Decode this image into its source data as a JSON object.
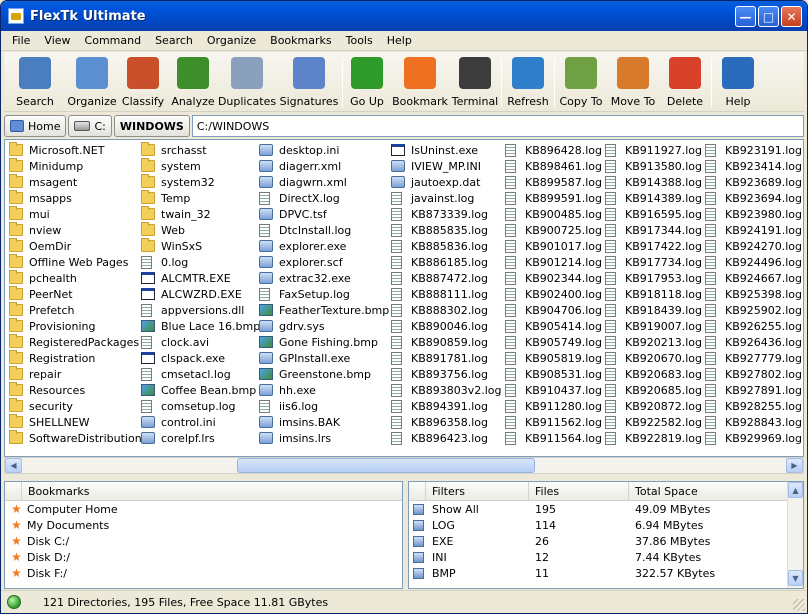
{
  "window": {
    "title": "FlexTk Ultimate"
  },
  "menu": [
    "File",
    "View",
    "Command",
    "Search",
    "Organize",
    "Bookmarks",
    "Tools",
    "Help"
  ],
  "toolbar": [
    {
      "label": "Search",
      "icon": "magnifier-icon",
      "color": "#4a7ebf"
    },
    {
      "label": "Organize",
      "icon": "organize-grid-icon",
      "color": "#5b8fd1"
    },
    {
      "label": "Classify",
      "icon": "classify-icon",
      "color": "#c9502b"
    },
    {
      "label": "Analyze",
      "icon": "analyze-drive-icon",
      "color": "#3f8e2c"
    },
    {
      "label": "Duplicates",
      "icon": "duplicates-icon",
      "color": "#8aa0bd"
    },
    {
      "label": "Signatures",
      "icon": "signatures-icon",
      "color": "#5d84c9"
    },
    {
      "label": "Go Up",
      "icon": "go-up-arrow-icon",
      "color": "#2f9b2a"
    },
    {
      "label": "Bookmark",
      "icon": "bookmark-star-icon",
      "color": "#ee7020"
    },
    {
      "label": "Terminal",
      "icon": "terminal-icon",
      "color": "#3c3c3c"
    },
    {
      "label": "Refresh",
      "icon": "refresh-icon",
      "color": "#2f7fcc"
    },
    {
      "label": "Copy To",
      "icon": "copy-to-icon",
      "color": "#6fa043"
    },
    {
      "label": "Move To",
      "icon": "move-to-icon",
      "color": "#d77a2c"
    },
    {
      "label": "Delete",
      "icon": "delete-icon",
      "color": "#d9412a"
    },
    {
      "label": "Help",
      "icon": "help-icon",
      "color": "#2a6bbd"
    }
  ],
  "address": {
    "crumbs": [
      "Home",
      "C:",
      "WINDOWS"
    ],
    "path": "C:/WINDOWS"
  },
  "files": {
    "columns": [
      [
        {
          "name": "Microsoft.NET",
          "type": "folder"
        },
        {
          "name": "Minidump",
          "type": "folder"
        },
        {
          "name": "msagent",
          "type": "folder"
        },
        {
          "name": "msapps",
          "type": "folder"
        },
        {
          "name": "mui",
          "type": "folder"
        },
        {
          "name": "nview",
          "type": "folder"
        },
        {
          "name": "OemDir",
          "type": "folder"
        },
        {
          "name": "Offline Web Pages",
          "type": "folder"
        },
        {
          "name": "pchealth",
          "type": "folder"
        },
        {
          "name": "PeerNet",
          "type": "folder"
        },
        {
          "name": "Prefetch",
          "type": "folder"
        },
        {
          "name": "Provisioning",
          "type": "folder"
        },
        {
          "name": "RegisteredPackages",
          "type": "folder"
        },
        {
          "name": "Registration",
          "type": "folder"
        },
        {
          "name": "repair",
          "type": "folder"
        },
        {
          "name": "Resources",
          "type": "folder"
        },
        {
          "name": "security",
          "type": "folder"
        },
        {
          "name": "SHELLNEW",
          "type": "folder"
        },
        {
          "name": "SoftwareDistribution",
          "type": "folder"
        }
      ],
      [
        {
          "name": "srchasst",
          "type": "folder"
        },
        {
          "name": "system",
          "type": "folder"
        },
        {
          "name": "system32",
          "type": "folder"
        },
        {
          "name": "Temp",
          "type": "folder"
        },
        {
          "name": "twain_32",
          "type": "folder"
        },
        {
          "name": "Web",
          "type": "folder"
        },
        {
          "name": "WinSxS",
          "type": "folder"
        },
        {
          "name": "0.log",
          "type": "doc"
        },
        {
          "name": "ALCMTR.EXE",
          "type": "exe"
        },
        {
          "name": "ALCWZRD.EXE",
          "type": "exe"
        },
        {
          "name": "appversions.dll",
          "type": "doc"
        },
        {
          "name": "Blue Lace 16.bmp",
          "type": "img"
        },
        {
          "name": "clock.avi",
          "type": "doc"
        },
        {
          "name": "clspack.exe",
          "type": "exe"
        },
        {
          "name": "cmsetacl.log",
          "type": "doc"
        },
        {
          "name": "Coffee Bean.bmp",
          "type": "img"
        },
        {
          "name": "comsetup.log",
          "type": "doc"
        },
        {
          "name": "control.ini",
          "type": "misc"
        },
        {
          "name": "corelpf.lrs",
          "type": "misc"
        }
      ],
      [
        {
          "name": "desktop.ini",
          "type": "misc"
        },
        {
          "name": "diagerr.xml",
          "type": "misc"
        },
        {
          "name": "diagwrn.xml",
          "type": "misc"
        },
        {
          "name": "DirectX.log",
          "type": "doc"
        },
        {
          "name": "DPVC.tsf",
          "type": "misc"
        },
        {
          "name": "DtcInstall.log",
          "type": "doc"
        },
        {
          "name": "explorer.exe",
          "type": "misc"
        },
        {
          "name": "explorer.scf",
          "type": "misc"
        },
        {
          "name": "extrac32.exe",
          "type": "misc"
        },
        {
          "name": "FaxSetup.log",
          "type": "doc"
        },
        {
          "name": "FeatherTexture.bmp",
          "type": "img"
        },
        {
          "name": "gdrv.sys",
          "type": "misc"
        },
        {
          "name": "Gone Fishing.bmp",
          "type": "img"
        },
        {
          "name": "GPInstall.exe",
          "type": "misc"
        },
        {
          "name": "Greenstone.bmp",
          "type": "img"
        },
        {
          "name": "hh.exe",
          "type": "misc"
        },
        {
          "name": "iis6.log",
          "type": "doc"
        },
        {
          "name": "imsins.BAK",
          "type": "misc"
        },
        {
          "name": "imsins.lrs",
          "type": "misc"
        }
      ],
      [
        {
          "name": "IsUninst.exe",
          "type": "exe"
        },
        {
          "name": "IVIEW_MP.INI",
          "type": "misc"
        },
        {
          "name": "jautoexp.dat",
          "type": "misc"
        },
        {
          "name": "javainst.log",
          "type": "doc"
        },
        {
          "name": "KB873339.log",
          "type": "doc"
        },
        {
          "name": "KB885835.log",
          "type": "doc"
        },
        {
          "name": "KB885836.log",
          "type": "doc"
        },
        {
          "name": "KB886185.log",
          "type": "doc"
        },
        {
          "name": "KB887472.log",
          "type": "doc"
        },
        {
          "name": "KB888111.log",
          "type": "doc"
        },
        {
          "name": "KB888302.log",
          "type": "doc"
        },
        {
          "name": "KB890046.log",
          "type": "doc"
        },
        {
          "name": "KB890859.log",
          "type": "doc"
        },
        {
          "name": "KB891781.log",
          "type": "doc"
        },
        {
          "name": "KB893756.log",
          "type": "doc"
        },
        {
          "name": "KB893803v2.log",
          "type": "doc"
        },
        {
          "name": "KB894391.log",
          "type": "doc"
        },
        {
          "name": "KB896358.log",
          "type": "doc"
        },
        {
          "name": "KB896423.log",
          "type": "doc"
        }
      ],
      [
        {
          "name": "KB896428.log",
          "type": "doc"
        },
        {
          "name": "KB898461.log",
          "type": "doc"
        },
        {
          "name": "KB899587.log",
          "type": "doc"
        },
        {
          "name": "KB899591.log",
          "type": "doc"
        },
        {
          "name": "KB900485.log",
          "type": "doc"
        },
        {
          "name": "KB900725.log",
          "type": "doc"
        },
        {
          "name": "KB901017.log",
          "type": "doc"
        },
        {
          "name": "KB901214.log",
          "type": "doc"
        },
        {
          "name": "KB902344.log",
          "type": "doc"
        },
        {
          "name": "KB902400.log",
          "type": "doc"
        },
        {
          "name": "KB904706.log",
          "type": "doc"
        },
        {
          "name": "KB905414.log",
          "type": "doc"
        },
        {
          "name": "KB905749.log",
          "type": "doc"
        },
        {
          "name": "KB905819.log",
          "type": "doc"
        },
        {
          "name": "KB908531.log",
          "type": "doc"
        },
        {
          "name": "KB910437.log",
          "type": "doc"
        },
        {
          "name": "KB911280.log",
          "type": "doc"
        },
        {
          "name": "KB911562.log",
          "type": "doc"
        },
        {
          "name": "KB911564.log",
          "type": "doc"
        }
      ],
      [
        {
          "name": "KB911927.log",
          "type": "doc"
        },
        {
          "name": "KB913580.log",
          "type": "doc"
        },
        {
          "name": "KB914388.log",
          "type": "doc"
        },
        {
          "name": "KB914389.log",
          "type": "doc"
        },
        {
          "name": "KB916595.log",
          "type": "doc"
        },
        {
          "name": "KB917344.log",
          "type": "doc"
        },
        {
          "name": "KB917422.log",
          "type": "doc"
        },
        {
          "name": "KB917734.log",
          "type": "doc"
        },
        {
          "name": "KB917953.log",
          "type": "doc"
        },
        {
          "name": "KB918118.log",
          "type": "doc"
        },
        {
          "name": "KB918439.log",
          "type": "doc"
        },
        {
          "name": "KB919007.log",
          "type": "doc"
        },
        {
          "name": "KB920213.log",
          "type": "doc"
        },
        {
          "name": "KB920670.log",
          "type": "doc"
        },
        {
          "name": "KB920683.log",
          "type": "doc"
        },
        {
          "name": "KB920685.log",
          "type": "doc"
        },
        {
          "name": "KB920872.log",
          "type": "doc"
        },
        {
          "name": "KB922582.log",
          "type": "doc"
        },
        {
          "name": "KB922819.log",
          "type": "doc"
        }
      ],
      [
        {
          "name": "KB923191.log",
          "type": "doc"
        },
        {
          "name": "KB923414.log",
          "type": "doc"
        },
        {
          "name": "KB923689.log",
          "type": "doc"
        },
        {
          "name": "KB923694.log",
          "type": "doc"
        },
        {
          "name": "KB923980.log",
          "type": "doc"
        },
        {
          "name": "KB924191.log",
          "type": "doc"
        },
        {
          "name": "KB924270.log",
          "type": "doc"
        },
        {
          "name": "KB924496.log",
          "type": "doc"
        },
        {
          "name": "KB924667.log",
          "type": "doc"
        },
        {
          "name": "KB925398.log",
          "type": "doc"
        },
        {
          "name": "KB925902.log",
          "type": "doc"
        },
        {
          "name": "KB926255.log",
          "type": "doc"
        },
        {
          "name": "KB926436.log",
          "type": "doc"
        },
        {
          "name": "KB927779.log",
          "type": "doc"
        },
        {
          "name": "KB927802.log",
          "type": "doc"
        },
        {
          "name": "KB927891.log",
          "type": "doc"
        },
        {
          "name": "KB928255.log",
          "type": "doc"
        },
        {
          "name": "KB928843.log",
          "type": "doc"
        },
        {
          "name": "KB929969.log",
          "type": "doc"
        }
      ]
    ]
  },
  "bookmarks": {
    "header": "Bookmarks",
    "items": [
      "Computer Home",
      "My Documents",
      "Disk C:/",
      "Disk D:/",
      "Disk F:/"
    ]
  },
  "filters": {
    "headers": [
      "Filters",
      "Files",
      "Total Space"
    ],
    "rows": [
      {
        "name": "Show All",
        "files": "195",
        "space": "49.09 MBytes"
      },
      {
        "name": "LOG",
        "files": "114",
        "space": "6.94 MBytes"
      },
      {
        "name": "EXE",
        "files": "26",
        "space": "37.86 MBytes"
      },
      {
        "name": "INI",
        "files": "12",
        "space": "7.44 KBytes"
      },
      {
        "name": "BMP",
        "files": "11",
        "space": "322.57 KBytes"
      }
    ]
  },
  "status": {
    "text": "121 Directories, 195 Files, Free Space 11.81 GBytes"
  }
}
